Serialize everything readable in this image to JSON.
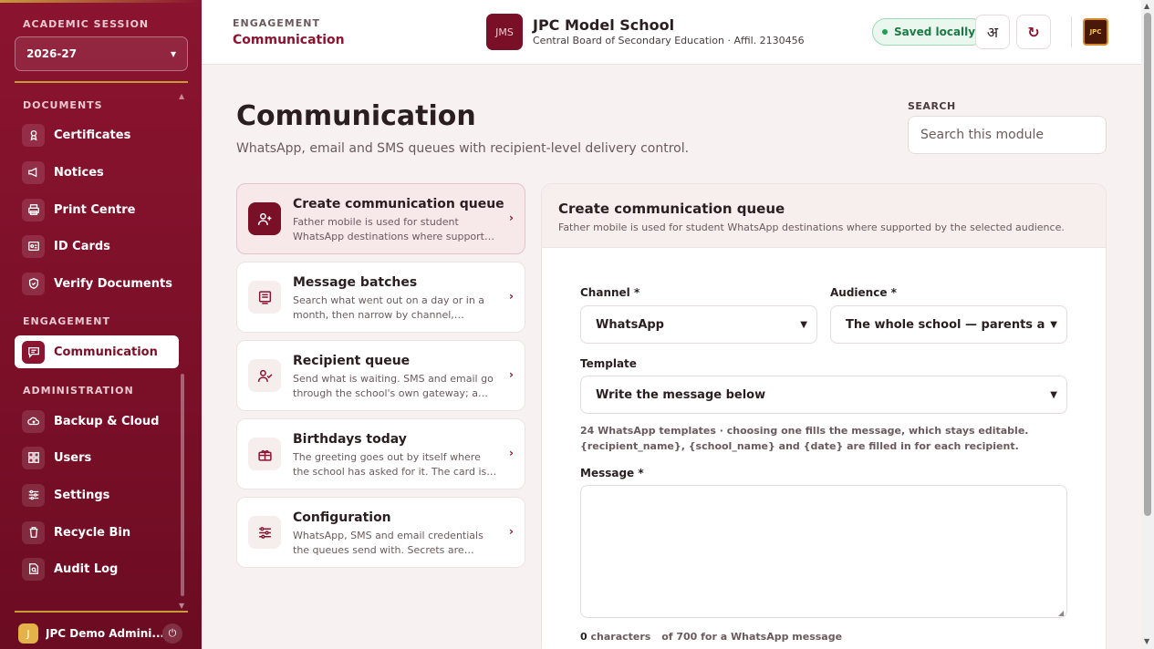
{
  "sidebar": {
    "session_label": "ACADEMIC SESSION",
    "session_value": "2026-27",
    "sections": {
      "documents": "DOCUMENTS",
      "engagement": "ENGAGEMENT",
      "administration": "ADMINISTRATION"
    },
    "items": [
      {
        "label": "Certificates",
        "icon": "certificate-icon"
      },
      {
        "label": "Notices",
        "icon": "megaphone-icon"
      },
      {
        "label": "Print Centre",
        "icon": "printer-icon"
      },
      {
        "label": "ID Cards",
        "icon": "id-card-icon"
      },
      {
        "label": "Verify Documents",
        "icon": "shield-check-icon"
      },
      {
        "label": "Communication",
        "icon": "message-icon"
      },
      {
        "label": "Backup & Cloud",
        "icon": "cloud-icon"
      },
      {
        "label": "Users",
        "icon": "grid-icon"
      },
      {
        "label": "Settings",
        "icon": "sliders-icon"
      },
      {
        "label": "Recycle Bin",
        "icon": "trash-icon"
      },
      {
        "label": "Audit Log",
        "icon": "audit-icon"
      }
    ],
    "user": {
      "initial": "J",
      "name": "JPC Demo Admini..."
    }
  },
  "header": {
    "crumb_top": "ENGAGEMENT",
    "crumb_main": "Communication",
    "logo_text": "JMS",
    "school_name": "JPC Model School",
    "school_sub": "Central Board of Secondary Education · Affil. 2130456",
    "saved_label": "Saved locally",
    "lang_button": "अ",
    "refresh_icon": "↻",
    "brand_text": "JPC"
  },
  "page": {
    "title": "Communication",
    "subtitle": "WhatsApp, email and SMS queues with recipient-level delivery control.",
    "search_label": "SEARCH",
    "search_placeholder": "Search this module"
  },
  "menu": [
    {
      "title": "Create communication queue",
      "desc": "Father mobile is used for student WhatsApp destinations where supported by the selected audience.",
      "active": true
    },
    {
      "title": "Message batches",
      "desc": "Search what went out on a day or in a month, then narrow by channel, audience or subject.",
      "active": false
    },
    {
      "title": "Recipient queue",
      "desc": "Send what is waiting. SMS and email go through the school's own gateway; a WhatsApp link opens for each recipient.",
      "active": false
    },
    {
      "title": "Birthdays today",
      "desc": "The greeting goes out by itself where the school has asked for it. The card is the same for every recipient.",
      "active": false
    },
    {
      "title": "Configuration",
      "desc": "WhatsApp, SMS and email credentials the queues send with. Secrets are stored write-only.",
      "active": false
    }
  ],
  "form": {
    "title": "Create communication queue",
    "subtitle": "Father mobile is used for student WhatsApp destinations where supported by the selected audience.",
    "channel_label": "Channel *",
    "channel_value": "WhatsApp",
    "audience_label": "Audience *",
    "audience_value": "The whole school — parents and staff",
    "template_label": "Template",
    "template_value": "Write the message below",
    "hint": "24 WhatsApp templates · choosing one fills the message, which stays editable. {recipient_name}, {school_name} and {date} are filled in for each recipient.",
    "message_label": "Message *",
    "char_count": "0",
    "char_label": "characters",
    "char_limit": "of 700 for a WhatsApp message"
  },
  "colors": {
    "brand": "#8b1430",
    "accent_gold": "#c99a3a",
    "saved_green": "#1d7a45"
  }
}
